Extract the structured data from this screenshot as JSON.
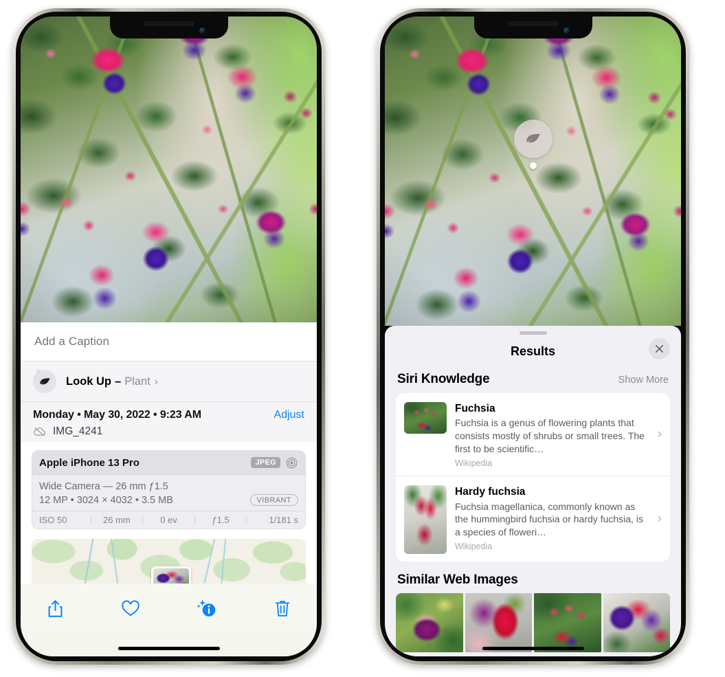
{
  "left_phone": {
    "caption": {
      "placeholder": "Add a Caption",
      "value": ""
    },
    "lookup": {
      "label": "Look Up",
      "dash": "–",
      "subject": "Plant",
      "chevron": "›",
      "icon": "leaf-icon",
      "sparkle_icon": "sparkle-icon"
    },
    "date": {
      "text": "Monday • May 30, 2022 • 9:23 AM",
      "adjust_label": "Adjust"
    },
    "file": {
      "name": "IMG_4241",
      "icon": "cloud-slash-icon"
    },
    "metadata": {
      "device": "Apple iPhone 13 Pro",
      "format_badge": "JPEG",
      "lens_icon": "aperture-icon",
      "lens_line": "Wide Camera — 26 mm ƒ1.5",
      "specs_line": "12 MP • 3024 × 4032 • 3.5 MB",
      "style_badge": "VIBRANT",
      "exif": [
        "ISO 50",
        "26 mm",
        "0 ev",
        "ƒ1.5",
        "1/181 s"
      ]
    },
    "toolbar": [
      {
        "name": "share-button",
        "icon": "share-icon"
      },
      {
        "name": "favorite-button",
        "icon": "heart-icon"
      },
      {
        "name": "info-button",
        "icon": "info-sparkle-icon"
      },
      {
        "name": "delete-button",
        "icon": "trash-icon"
      }
    ],
    "accent_color": "#0a84ff"
  },
  "right_phone": {
    "badge": {
      "icon": "leaf-icon",
      "name": "visual-lookup-leaf-badge"
    },
    "panel": {
      "title": "Results",
      "close_icon": "close-icon",
      "sections": [
        {
          "title": "Siri Knowledge",
          "action": "Show More",
          "items": [
            {
              "title": "Fuchsia",
              "description": "Fuchsia is a genus of flowering plants that consists mostly of shrubs or small trees. The first to be scientific…",
              "source": "Wikipedia",
              "chevron": "›"
            },
            {
              "title": "Hardy fuchsia",
              "description": "Fuchsia magellanica, commonly known as the hummingbird fuchsia or hardy fuchsia, is a species of floweri…",
              "source": "Wikipedia",
              "chevron": "›"
            }
          ]
        },
        {
          "title": "Similar Web Images",
          "thumbnail_count": 4
        }
      ]
    }
  }
}
